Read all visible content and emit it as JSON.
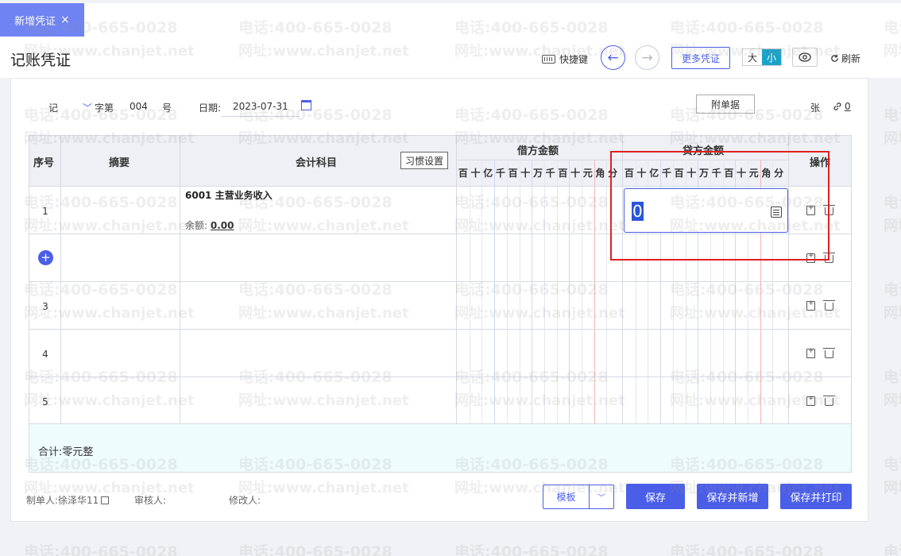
{
  "tab": {
    "label": "新增凭证",
    "close": "×"
  },
  "header": {
    "title": "记账凭证",
    "shortcut_label": "快捷键",
    "prev_symbol": "←",
    "next_symbol": "→",
    "more_label": "更多凭证",
    "size_large": "大",
    "size_small": "小",
    "refresh_label": "刷新"
  },
  "meta": {
    "voucher_type": "记",
    "zi_label": "字第",
    "number": "004",
    "hao": "号",
    "date_label": "日期:",
    "date_value": "2023-07-31",
    "attach_label": "附单据",
    "zhang": "张",
    "link_count": "0"
  },
  "table": {
    "col_seq": "序号",
    "col_summary": "摘要",
    "col_subject": "会计科目",
    "habit_btn": "习惯设置",
    "col_debit": "借方金额",
    "col_credit": "贷方金额",
    "col_ops": "操作",
    "digits": [
      "百",
      "十",
      "亿",
      "千",
      "百",
      "十",
      "万",
      "千",
      "百",
      "十",
      "元",
      "角",
      "分"
    ],
    "rows": [
      {
        "seq": "1",
        "subject": "6001 主营业务收入",
        "balance_label": "余额:",
        "balance_value": "0.00",
        "credit_input": "0"
      },
      {
        "seq": ""
      },
      {
        "seq": "3"
      },
      {
        "seq": "4"
      },
      {
        "seq": "5"
      }
    ],
    "add_symbol": "+",
    "total_label": "合计:零元整"
  },
  "footer": {
    "maker_label": "制单人:",
    "maker_name": "徐泽华11",
    "auditor_label": "审核人:",
    "modifier_label": "修改人:",
    "template_label": "模板",
    "template_dd": "﹀",
    "save": "保存",
    "save_new": "保存并新增",
    "save_print": "保存并打印"
  },
  "watermark": {
    "phone": "电话:400-665-0028",
    "site": "网址:www.chanjet.net"
  },
  "colors": {
    "accent": "#4b5ee8",
    "tab": "#6f83f2",
    "highlight": "#e02020",
    "total_bg": "#effcfd"
  }
}
